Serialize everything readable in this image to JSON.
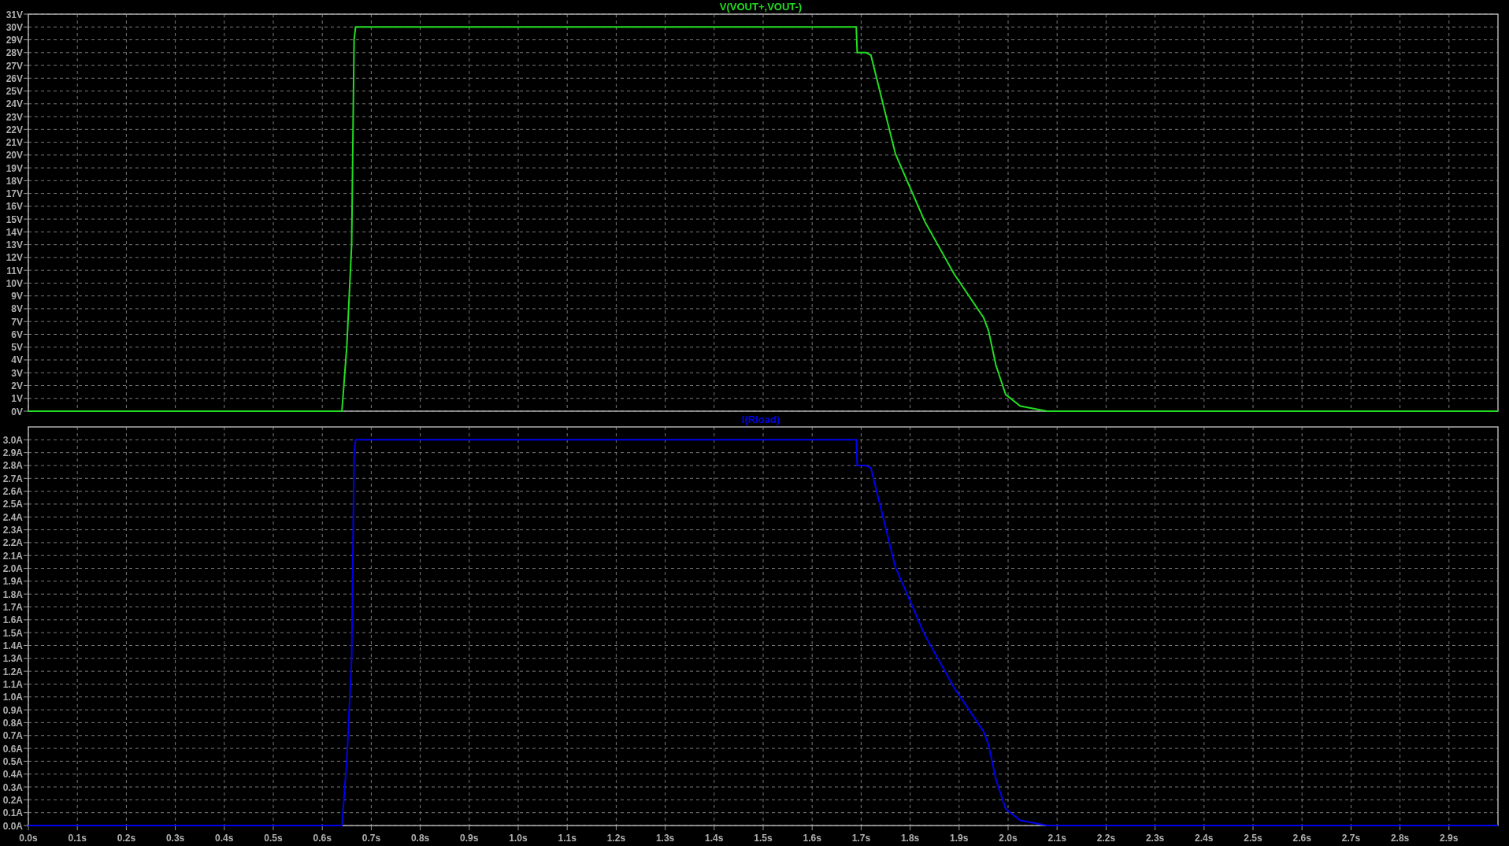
{
  "charts": [
    {
      "chart_data": {
        "type": "line",
        "grid": true,
        "xlim": [
          0,
          3
        ],
        "ylim": [
          0,
          31
        ],
        "x": [
          0,
          0.64,
          0.65,
          0.66,
          0.665,
          0.668,
          1.69,
          1.692,
          1.71,
          1.72,
          1.77,
          1.83,
          1.89,
          1.95,
          1.96,
          1.975,
          1.995,
          2.025,
          2.08,
          3.0
        ],
        "series": [
          {
            "name": "V(VOUT+,VOUT-)",
            "color": "#22dd22",
            "values": [
              0,
              0,
              5,
              13,
              29,
              30,
              30,
              28,
              28,
              27.8,
              20.1,
              14.8,
              10.7,
              7.3,
              6.3,
              3.6,
              1.3,
              0.4,
              0,
              0
            ]
          }
        ],
        "yticks": [
          {
            "value": 0,
            "label": "0V"
          },
          {
            "value": 1,
            "label": "1V"
          },
          {
            "value": 2,
            "label": "2V"
          },
          {
            "value": 3,
            "label": "3V"
          },
          {
            "value": 4,
            "label": "4V"
          },
          {
            "value": 5,
            "label": "5V"
          },
          {
            "value": 6,
            "label": "6V"
          },
          {
            "value": 7,
            "label": "7V"
          },
          {
            "value": 8,
            "label": "8V"
          },
          {
            "value": 9,
            "label": "9V"
          },
          {
            "value": 10,
            "label": "10V"
          },
          {
            "value": 11,
            "label": "11V"
          },
          {
            "value": 12,
            "label": "12V"
          },
          {
            "value": 13,
            "label": "13V"
          },
          {
            "value": 14,
            "label": "14V"
          },
          {
            "value": 15,
            "label": "15V"
          },
          {
            "value": 16,
            "label": "16V"
          },
          {
            "value": 17,
            "label": "17V"
          },
          {
            "value": 18,
            "label": "18V"
          },
          {
            "value": 19,
            "label": "19V"
          },
          {
            "value": 20,
            "label": "20V"
          },
          {
            "value": 21,
            "label": "21V"
          },
          {
            "value": 22,
            "label": "22V"
          },
          {
            "value": 23,
            "label": "23V"
          },
          {
            "value": 24,
            "label": "24V"
          },
          {
            "value": 25,
            "label": "25V"
          },
          {
            "value": 26,
            "label": "26V"
          },
          {
            "value": 27,
            "label": "27V"
          },
          {
            "value": 28,
            "label": "28V"
          },
          {
            "value": 29,
            "label": "29V"
          },
          {
            "value": 30,
            "label": "30V"
          },
          {
            "value": 31,
            "label": "31V"
          }
        ]
      }
    },
    {
      "chart_data": {
        "type": "line",
        "grid": true,
        "xlim": [
          0,
          3
        ],
        "ylim": [
          0,
          3.1
        ],
        "x": [
          0,
          0.64,
          0.65,
          0.66,
          0.665,
          0.668,
          1.69,
          1.692,
          1.71,
          1.72,
          1.77,
          1.83,
          1.89,
          1.95,
          1.96,
          1.975,
          1.995,
          2.025,
          2.08,
          3.0
        ],
        "series": [
          {
            "name": "I(Rload)",
            "color": "#0000ee",
            "values": [
              0,
              0,
              0.5,
              1.3,
              2.9,
              3.0,
              3.0,
              2.8,
              2.8,
              2.78,
              2.01,
              1.48,
              1.07,
              0.73,
              0.63,
              0.36,
              0.13,
              0.04,
              0,
              0
            ]
          }
        ],
        "xticks": [
          {
            "value": 0,
            "label": "0.0s"
          },
          {
            "value": 0.1,
            "label": "0.1s"
          },
          {
            "value": 0.2,
            "label": "0.2s"
          },
          {
            "value": 0.3,
            "label": "0.3s"
          },
          {
            "value": 0.4,
            "label": "0.4s"
          },
          {
            "value": 0.5,
            "label": "0.5s"
          },
          {
            "value": 0.6,
            "label": "0.6s"
          },
          {
            "value": 0.7,
            "label": "0.7s"
          },
          {
            "value": 0.8,
            "label": "0.8s"
          },
          {
            "value": 0.9,
            "label": "0.9s"
          },
          {
            "value": 1.0,
            "label": "1.0s"
          },
          {
            "value": 1.1,
            "label": "1.1s"
          },
          {
            "value": 1.2,
            "label": "1.2s"
          },
          {
            "value": 1.3,
            "label": "1.3s"
          },
          {
            "value": 1.4,
            "label": "1.4s"
          },
          {
            "value": 1.5,
            "label": "1.5s"
          },
          {
            "value": 1.6,
            "label": "1.6s"
          },
          {
            "value": 1.7,
            "label": "1.7s"
          },
          {
            "value": 1.8,
            "label": "1.8s"
          },
          {
            "value": 1.9,
            "label": "1.9s"
          },
          {
            "value": 2.0,
            "label": "2.0s"
          },
          {
            "value": 2.1,
            "label": "2.1s"
          },
          {
            "value": 2.2,
            "label": "2.2s"
          },
          {
            "value": 2.3,
            "label": "2.3s"
          },
          {
            "value": 2.4,
            "label": "2.4s"
          },
          {
            "value": 2.5,
            "label": "2.5s"
          },
          {
            "value": 2.6,
            "label": "2.6s"
          },
          {
            "value": 2.7,
            "label": "2.7s"
          },
          {
            "value": 2.8,
            "label": "2.8s"
          },
          {
            "value": 2.9,
            "label": "2.9s"
          }
        ],
        "yticks": [
          {
            "value": 0,
            "label": "0.0A"
          },
          {
            "value": 0.1,
            "label": "0.1A"
          },
          {
            "value": 0.2,
            "label": "0.2A"
          },
          {
            "value": 0.3,
            "label": "0.3A"
          },
          {
            "value": 0.4,
            "label": "0.4A"
          },
          {
            "value": 0.5,
            "label": "0.5A"
          },
          {
            "value": 0.6,
            "label": "0.6A"
          },
          {
            "value": 0.7,
            "label": "0.7A"
          },
          {
            "value": 0.8,
            "label": "0.8A"
          },
          {
            "value": 0.9,
            "label": "0.9A"
          },
          {
            "value": 1.0,
            "label": "1.0A"
          },
          {
            "value": 1.1,
            "label": "1.1A"
          },
          {
            "value": 1.2,
            "label": "1.2A"
          },
          {
            "value": 1.3,
            "label": "1.3A"
          },
          {
            "value": 1.4,
            "label": "1.4A"
          },
          {
            "value": 1.5,
            "label": "1.5A"
          },
          {
            "value": 1.6,
            "label": "1.6A"
          },
          {
            "value": 1.7,
            "label": "1.7A"
          },
          {
            "value": 1.8,
            "label": "1.8A"
          },
          {
            "value": 1.9,
            "label": "1.9A"
          },
          {
            "value": 2.0,
            "label": "2.0A"
          },
          {
            "value": 2.1,
            "label": "2.1A"
          },
          {
            "value": 2.2,
            "label": "2.2A"
          },
          {
            "value": 2.3,
            "label": "2.3A"
          },
          {
            "value": 2.4,
            "label": "2.4A"
          },
          {
            "value": 2.5,
            "label": "2.5A"
          },
          {
            "value": 2.6,
            "label": "2.6A"
          },
          {
            "value": 2.7,
            "label": "2.7A"
          },
          {
            "value": 2.8,
            "label": "2.8A"
          },
          {
            "value": 2.9,
            "label": "2.9A"
          },
          {
            "value": 3.0,
            "label": "3.0A"
          }
        ]
      }
    }
  ]
}
